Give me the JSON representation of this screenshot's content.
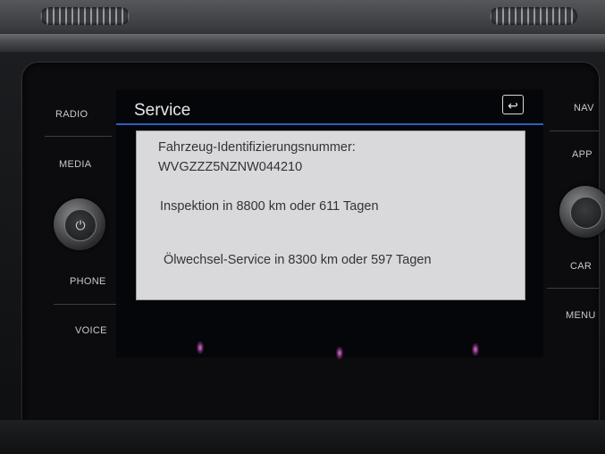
{
  "left_buttons": {
    "radio": "RADIO",
    "media": "MEDIA",
    "phone": "PHONE",
    "voice": "VOICE"
  },
  "right_buttons": {
    "nav": "NAV",
    "app": "APP",
    "car": "CAR",
    "menu": "MENU"
  },
  "screen": {
    "title": "Service",
    "back_icon": "↩"
  },
  "service_info": {
    "vin_label": "Fahrzeug-Identifizierungsnummer:",
    "vin_value": "WVGZZZ5NZNW044210",
    "inspection": "Inspektion in 8800 km oder 611 Tagen",
    "oil_service": "Ölwechsel-Service in 8300 km oder 597 Tagen"
  },
  "icons": {
    "power": "⏻"
  }
}
